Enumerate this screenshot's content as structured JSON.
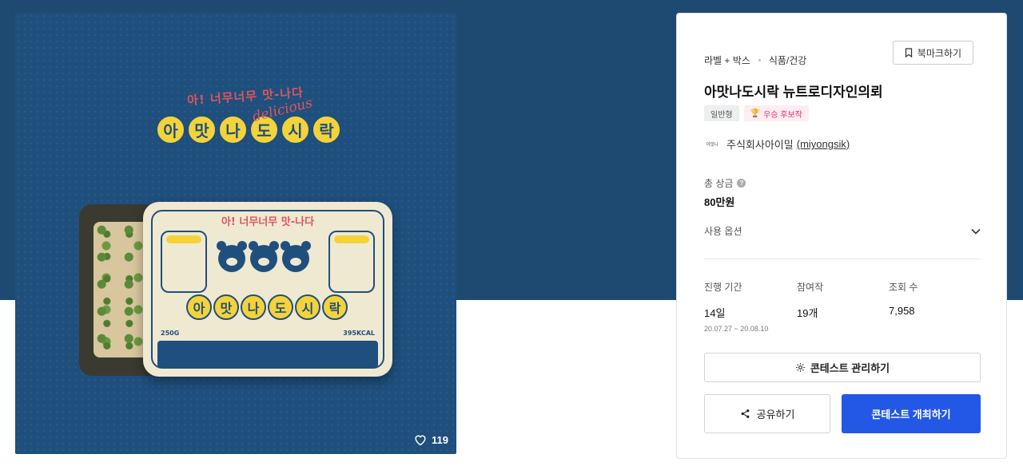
{
  "artwork": {
    "tagline": "아! 너무너무 맛-나다",
    "brand_chars": [
      "아",
      "맛",
      "나",
      "도",
      "시",
      "락"
    ],
    "script_word": "delicious",
    "lid": {
      "tagline": "아! 너무너무 맛-나다",
      "weight": "250G",
      "kcal": "395KCAL"
    },
    "like_count": "119"
  },
  "panel": {
    "breadcrumb": [
      "라벨 + 박스",
      "식품/건강"
    ],
    "bookmark_label": "북마크하기",
    "title": "아맛나도시락 뉴트로디자인의뢰",
    "tags": {
      "type": "일반형",
      "award": "우승 후보작"
    },
    "owner": {
      "logo_text": "아맛나",
      "company": "주식회사아이밀",
      "username": "(miyongsik)"
    },
    "prize": {
      "label": "총 상금",
      "help": "?",
      "value": "80만원"
    },
    "usage_options_label": "사용 옵션",
    "stats": {
      "duration": {
        "label": "진행 기간",
        "value": "14일",
        "range": "20.07.27 ~ 20.08.10"
      },
      "participants": {
        "label": "참여작",
        "value": "19개"
      },
      "views": {
        "label": "조회 수",
        "value": "7,958"
      }
    },
    "buttons": {
      "manage": "콘테스트 관리하기",
      "share": "공유하기",
      "host": "콘테스트 개최하기"
    }
  },
  "colors": {
    "band": "#1e4a72",
    "artwork_bg": "#1f4f7d",
    "accent_yellow": "#f4d33a",
    "accent_red": "#e0555a",
    "primary_button": "#2357e6"
  }
}
